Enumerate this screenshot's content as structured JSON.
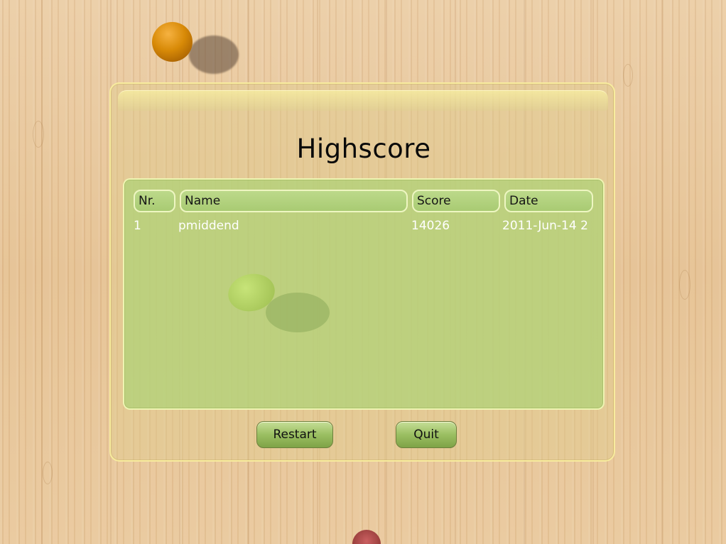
{
  "dialog": {
    "title": "Highscore"
  },
  "table": {
    "columns": [
      "Nr.",
      "Name",
      "Score",
      "Date"
    ],
    "rows": [
      {
        "nr": "1",
        "name": "pmiddend",
        "score": "14026",
        "date": "2011-Jun-14 2"
      }
    ]
  },
  "buttons": {
    "restart_label": "Restart",
    "quit_label": "Quit"
  },
  "colors": {
    "panel_green": "#b2d278",
    "button_green": "#9bbf62",
    "ball_orange": "#d88a07",
    "wood": "#e8c79c"
  }
}
